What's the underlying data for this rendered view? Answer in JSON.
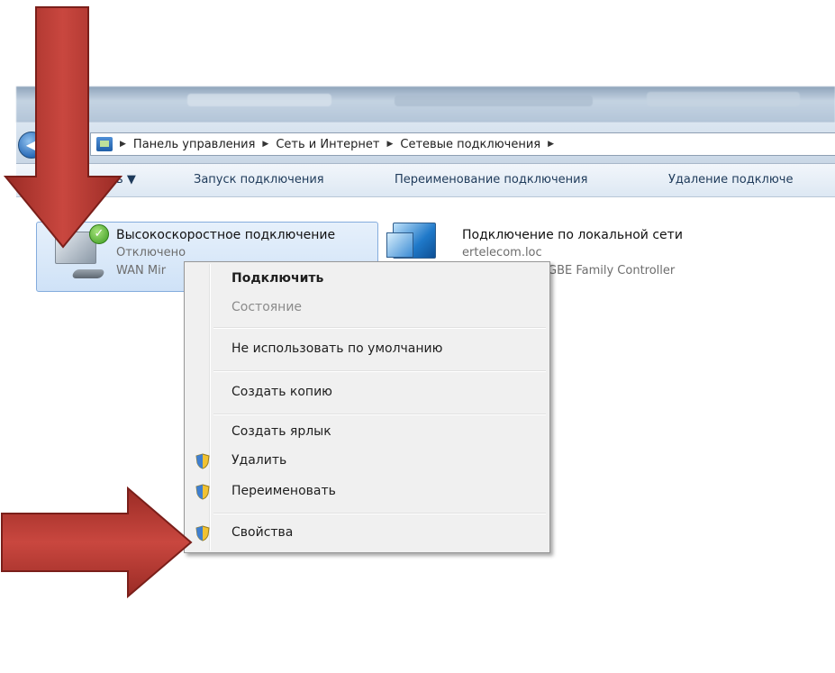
{
  "address": {
    "crumbs": [
      "Панель управления",
      "Сеть и Интернет",
      "Сетевые подключения"
    ]
  },
  "toolbar": {
    "organize_partial": "ить ▼",
    "start_connection": "Запуск подключения",
    "rename_connection": "Переименование подключения",
    "delete_connection_partial": "Удаление подключе"
  },
  "connections": [
    {
      "title": "Высокоскоростное подключение",
      "status": "Отключено",
      "device_partial": "WAN Mir"
    },
    {
      "title": "Подключение по локальной сети",
      "domain_partial": "ertelecom.loc",
      "device_partial": "GBE Family Controller"
    }
  ],
  "context_menu": {
    "items": [
      {
        "label": "Подключить"
      },
      {
        "label": "Состояние"
      },
      {
        "label": "Не использовать по умолчанию"
      },
      {
        "label": "Создать копию"
      },
      {
        "label": "Создать ярлык"
      },
      {
        "label": "Удалить"
      },
      {
        "label": "Переименовать"
      },
      {
        "label": "Свойства"
      }
    ]
  },
  "colors": {
    "arrow": "#b5362f",
    "selection": "#cfe2f7",
    "menu_bg": "#f0f0f0"
  },
  "icons": [
    "back-arrow-icon",
    "forward-arrow-icon",
    "network-folder-icon",
    "connected-check-icon",
    "monitor-icon",
    "modem-icon",
    "lan-icon",
    "uac-shield-icon"
  ]
}
